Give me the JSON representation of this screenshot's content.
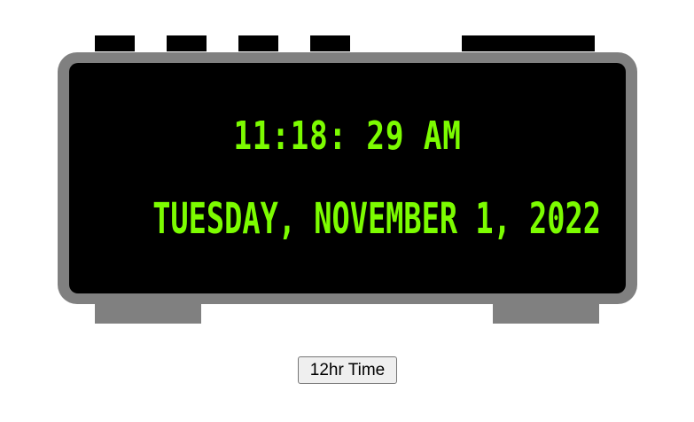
{
  "clock": {
    "time": "11:18: 29 AM",
    "date": "TUESDAY, NOVEMBER 1, 2022",
    "display_color": "#7cfc00",
    "body_color": "#808080",
    "screen_color": "#000000"
  },
  "controls": {
    "mode_button_label": "12hr Time"
  }
}
